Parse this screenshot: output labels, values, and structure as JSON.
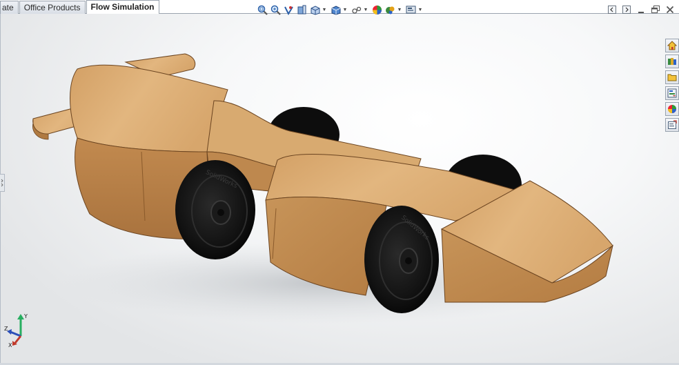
{
  "document_tabs": [
    {
      "label": "ate",
      "active": false
    },
    {
      "label": "Office Products",
      "active": false
    },
    {
      "label": "Flow Simulation",
      "active": true
    }
  ],
  "heads_up_toolbar": [
    {
      "icon": "zoom-to-fit-icon",
      "has_dropdown": false
    },
    {
      "icon": "zoom-to-area-icon",
      "has_dropdown": false
    },
    {
      "icon": "previous-view-icon",
      "has_dropdown": false
    },
    {
      "icon": "section-view-icon",
      "has_dropdown": false
    },
    {
      "icon": "view-orientation-icon",
      "has_dropdown": true
    },
    {
      "icon": "display-style-icon",
      "has_dropdown": true
    },
    {
      "icon": "hide-show-items-icon",
      "has_dropdown": true
    },
    {
      "icon": "edit-appearance-icon",
      "has_dropdown": false
    },
    {
      "icon": "apply-scene-icon",
      "has_dropdown": true
    },
    {
      "icon": "view-settings-icon",
      "has_dropdown": true
    }
  ],
  "window_controls": [
    "tile-left-icon",
    "tile-right-icon",
    "minimize-icon",
    "restore-icon",
    "close-icon"
  ],
  "task_pane": [
    {
      "icon": "solidworks-resources-icon"
    },
    {
      "icon": "design-library-icon"
    },
    {
      "icon": "file-explorer-icon"
    },
    {
      "icon": "view-palette-icon"
    },
    {
      "icon": "appearances-scenes-icon"
    },
    {
      "icon": "custom-properties-icon"
    }
  ],
  "wheel_text": "SolidWorks",
  "triad": {
    "x": "X",
    "y": "Y",
    "z": "Z"
  },
  "colors": {
    "wood_light": "#d9a86e",
    "wood_mid": "#c48f55",
    "wood_dark": "#a06a35",
    "tire": "#111111",
    "triad_x": "#c0392b",
    "triad_y": "#27ae60",
    "triad_z": "#2c4fb8"
  }
}
